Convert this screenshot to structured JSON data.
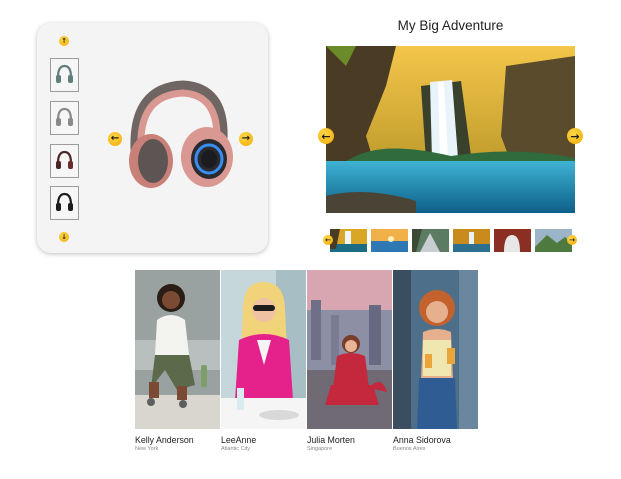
{
  "product_gallery": {
    "up_arrow": "↑",
    "down_arrow": "↓",
    "prev_arrow": "←",
    "next_arrow": "→",
    "thumbnails": [
      {
        "icon": "headphones-teal-icon",
        "color": "#5e7f7c"
      },
      {
        "icon": "headphones-grey-icon",
        "color": "#8a8a8a"
      },
      {
        "icon": "headphones-dark-red-icon",
        "color": "#4a2628"
      },
      {
        "icon": "headphones-black-icon",
        "color": "#1d1d1d"
      }
    ],
    "main_image": {
      "icon": "pink-headphones-icon",
      "color": "#d99891",
      "accent": "#3a8df0"
    }
  },
  "image_slider": {
    "title": "My Big Adventure",
    "prev_arrow": "←",
    "next_arrow": "→",
    "thumbnails": [
      {
        "icon": "waterfall-thumb",
        "sky": "#d9a626",
        "ground": "#1c6c86"
      },
      {
        "icon": "seaside-thumb",
        "sky": "#f2b04a",
        "ground": "#2e79b4"
      },
      {
        "icon": "river-thumb",
        "sky": "#5b7b63",
        "ground": "#c9ced1"
      },
      {
        "icon": "forest-falls-thumb",
        "sky": "#c98a1e",
        "ground": "#2d6f8e"
      },
      {
        "icon": "cave-arch-thumb",
        "sky": "#8b2f24",
        "ground": "#e7e7e7"
      },
      {
        "icon": "mountain-thumb",
        "sky": "#9cb4c8",
        "ground": "#4e7a3f"
      }
    ]
  },
  "team": [
    {
      "name": "Kelly Anderson",
      "city": "New York",
      "colors": {
        "bg": "#9aa2a1",
        "top": "#f3f3f0",
        "bottom": "#5b6a4a",
        "skin": "#7a4a32"
      }
    },
    {
      "name": "LeeAnne",
      "city": "Atlantic City",
      "colors": {
        "bg": "#c6d7dc",
        "top": "#e5228b",
        "bottom": "#f5f5f5",
        "skin": "#f0c2a4"
      }
    },
    {
      "name": "Julia Morten",
      "city": "Singapore",
      "colors": {
        "bg": "#8d8fa5",
        "top": "#c4283d",
        "bottom": "#6f6a73",
        "skin": "#e8b596"
      }
    },
    {
      "name": "Anna Sidorova",
      "city": "Buenos Aires",
      "colors": {
        "bg": "#4e6f8a",
        "top": "#efe6b0",
        "bottom": "#2f5c93",
        "skin": "#e6b08e"
      }
    }
  ]
}
